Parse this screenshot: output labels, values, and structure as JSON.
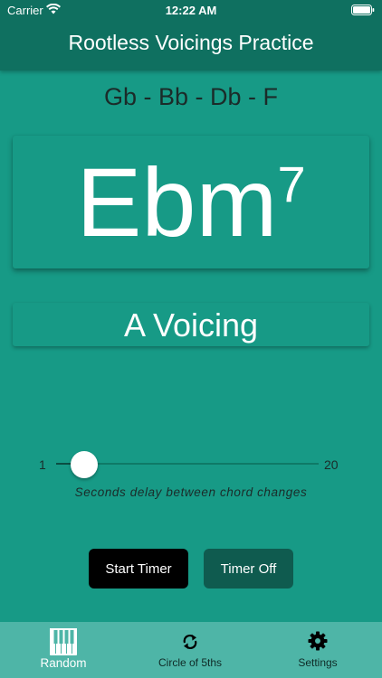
{
  "status_bar": {
    "carrier": "Carrier",
    "time": "12:22 AM"
  },
  "nav": {
    "title": "Rootless Voicings Practice"
  },
  "notes": "Gb - Bb - Db - F",
  "chord": {
    "root": "Ebm",
    "extension": "7"
  },
  "voicing": {
    "label": "A Voicing"
  },
  "slider": {
    "min_label": "1",
    "max_label": "20",
    "min": 1,
    "max": 20,
    "value": 3,
    "caption": "Seconds delay between chord changes"
  },
  "buttons": {
    "start": "Start Timer",
    "off": "Timer Off"
  },
  "tabs": [
    {
      "label": "Random",
      "icon": "piano-icon",
      "selected": true
    },
    {
      "label": "Circle of 5ths",
      "icon": "refresh-icon",
      "selected": false
    },
    {
      "label": "Settings",
      "icon": "gear-icon",
      "selected": false
    }
  ],
  "colors": {
    "background": "#179a86",
    "nav_bar": "#0f7060",
    "tab_bar": "#4eb5a7",
    "start_button": "#000000",
    "off_button": "#0f5b4f"
  }
}
